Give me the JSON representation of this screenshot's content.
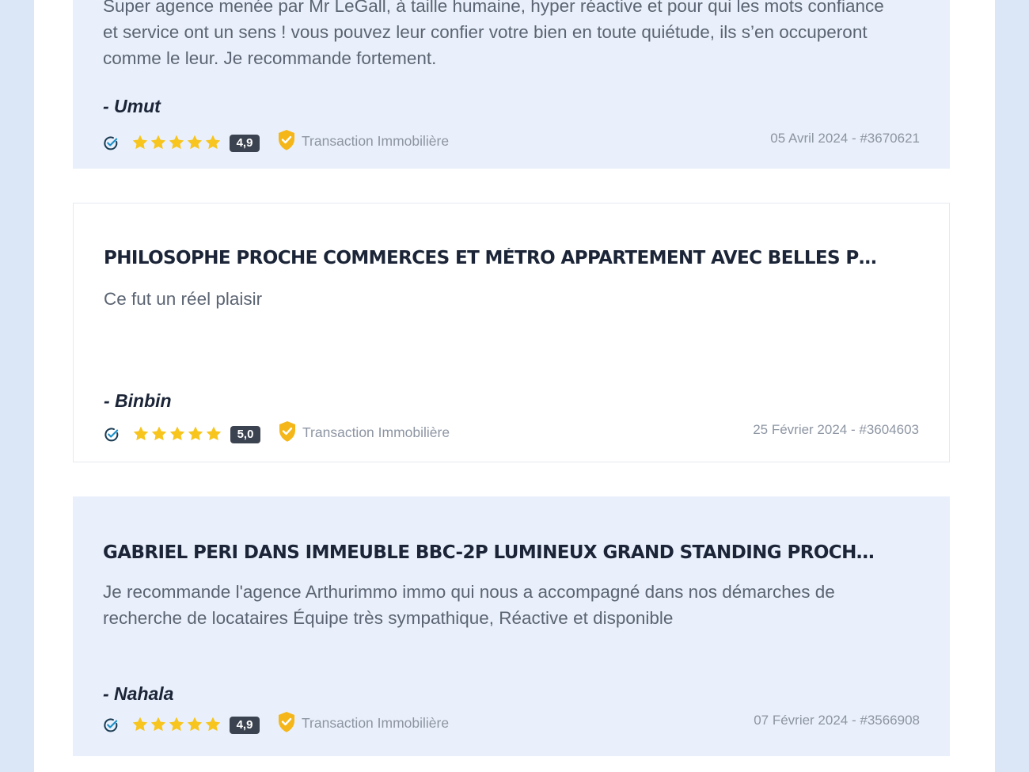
{
  "reviews": [
    {
      "title": "",
      "text": "Super agence menée par Mr LeGall, à taille humaine, hyper réactive et pour qui les mots confiance et service ont un sens ! vous pouvez leur confier votre bien en toute quiétude, ils s’en occuperont comme le leur. Je recommande fortement.",
      "author": "- Umut",
      "rating": "4,9",
      "category": "Transaction Immobilière",
      "date": "05 Avril 2024 - #3670621"
    },
    {
      "title": "PHILOSOPHE PROCHE COMMERCES ET MÉTRO APPARTEMENT AVEC BELLES PRE...",
      "text": "Ce fut un réel plaisir",
      "author": "- Binbin",
      "rating": "5,0",
      "category": "Transaction Immobilière",
      "date": "25 Février 2024 - #3604603"
    },
    {
      "title": "GABRIEL PERI DANS IMMEUBLE BBC-2P LUMINEUX GRAND STANDING PROCHE ...",
      "text": "Je recommande l'agence Arthurimmo immo qui nous a accompagné dans nos démarches de recherche de locataires Équipe très sympathique, Réactive et disponible",
      "author": "- Nahala",
      "rating": "4,9",
      "category": "Transaction Immobilière",
      "date": "07 Février 2024 - #3566908"
    }
  ],
  "icons": {
    "verified": "check-circle-icon",
    "star": "star-icon",
    "category": "shield-check-icon"
  },
  "colors": {
    "star": "#f7c51e",
    "shield": "#f5b619",
    "check": "#1c8fc9",
    "card_bg": "#e9f0fb"
  }
}
